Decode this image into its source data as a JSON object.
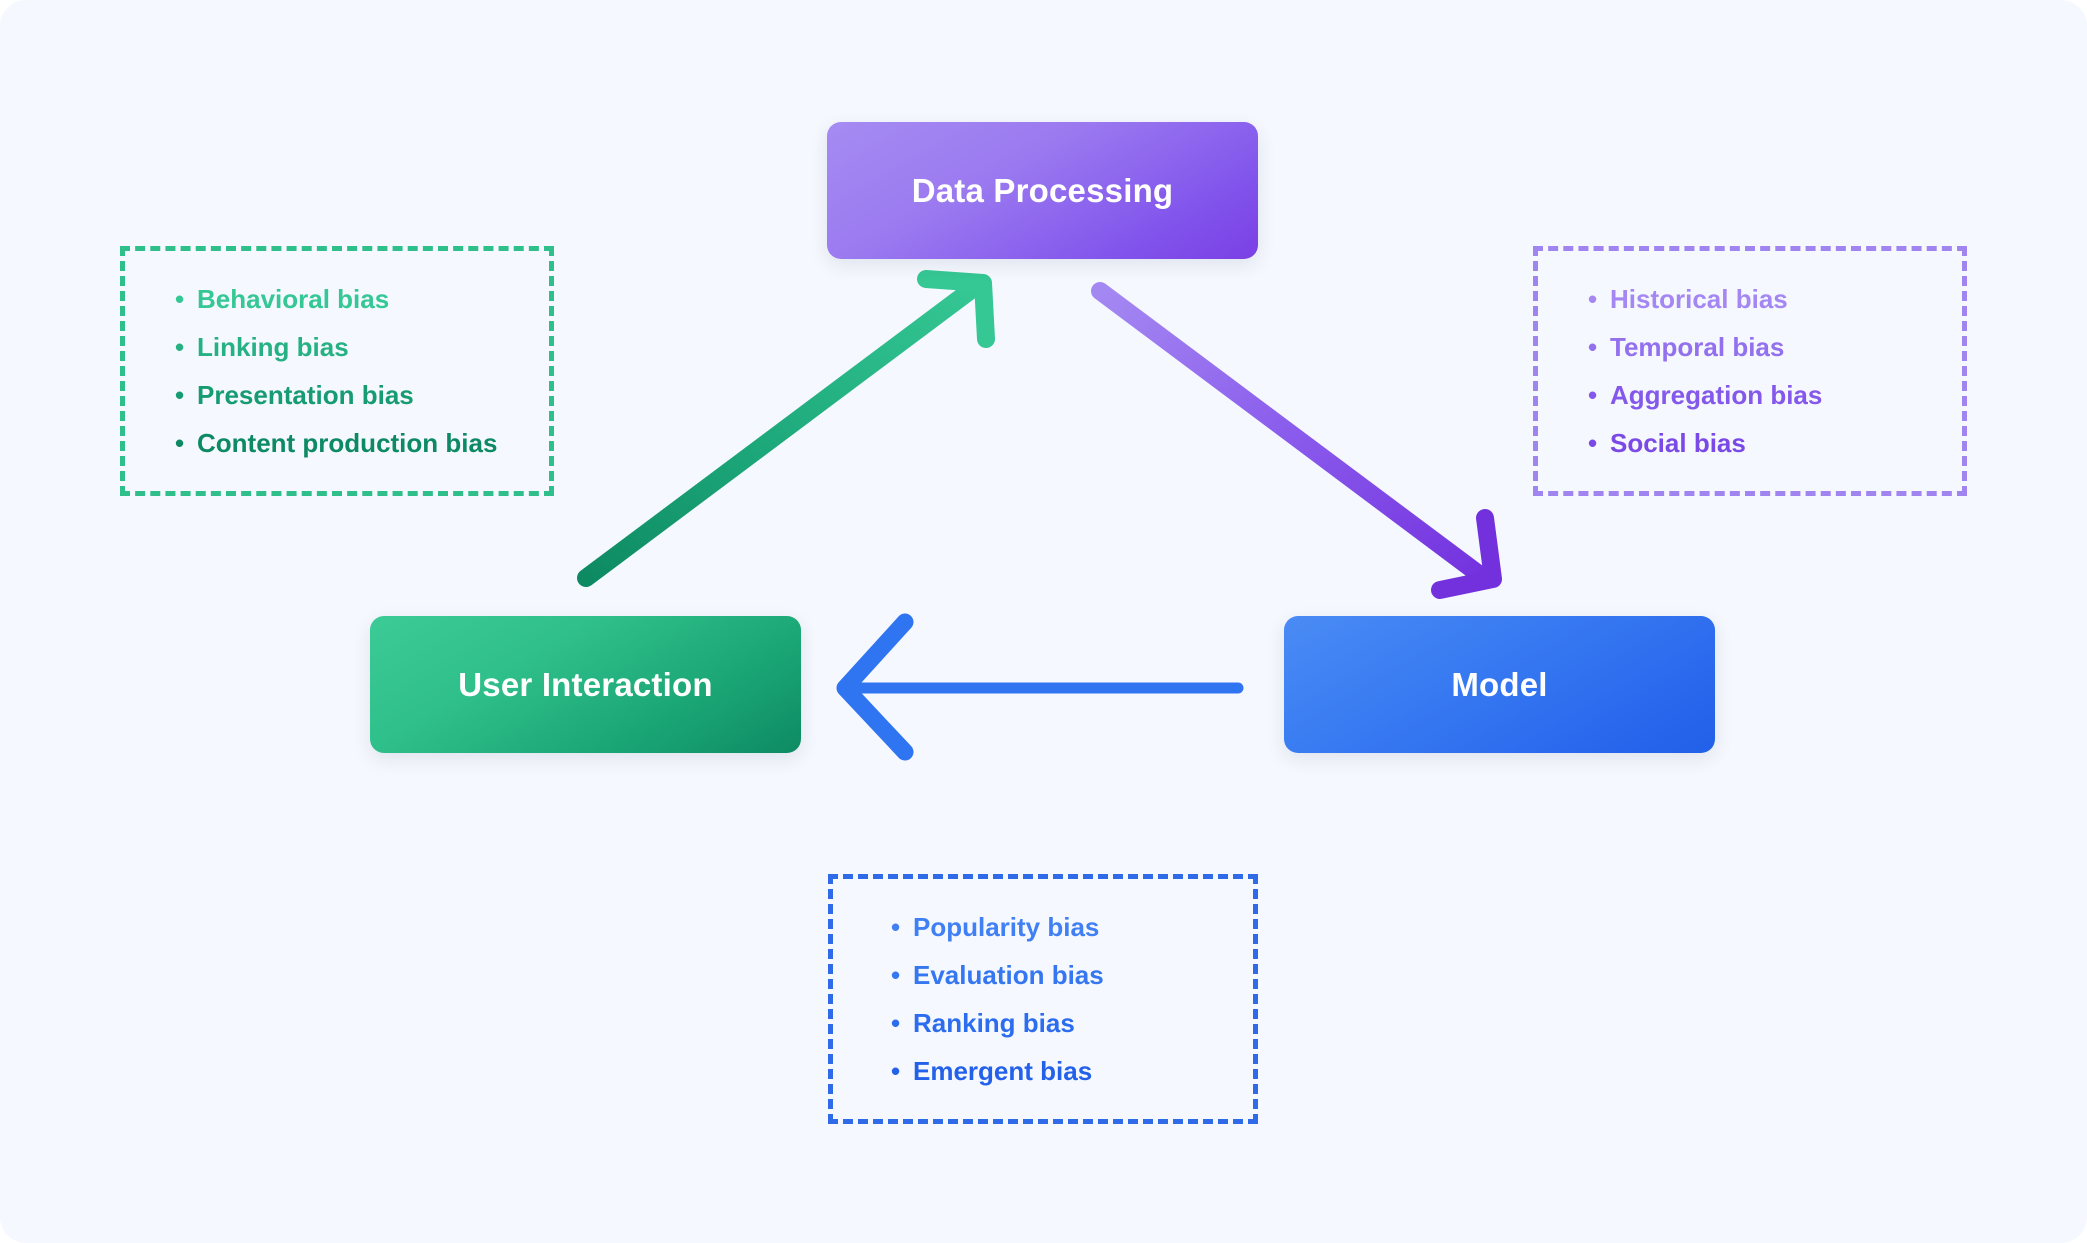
{
  "canvas": {
    "background_color": "#F5F8FE"
  },
  "nodes": [
    {
      "id": "data-processing",
      "label": "Data Processing",
      "color": "#8154EC"
    },
    {
      "id": "user-interaction",
      "label": "User Interaction",
      "color": "#18A273"
    },
    {
      "id": "model",
      "label": "Model",
      "color": "#2B6AEE"
    }
  ],
  "bias_boxes": [
    {
      "id": "user-interaction-biases",
      "border_color": "#2FBF8A",
      "bullet": "•",
      "items": [
        "Behavioral bias",
        "Linking bias",
        "Presentation bias",
        "Content production bias"
      ]
    },
    {
      "id": "data-processing-biases",
      "border_color": "#A084F0",
      "bullet": "•",
      "items": [
        "Historical bias",
        "Temporal bias",
        "Aggregation bias",
        "Social bias"
      ]
    },
    {
      "id": "model-biases",
      "border_color": "#2F6AE8",
      "bullet": "•",
      "items": [
        "Popularity bias",
        "Evaluation bias",
        "Ranking bias",
        "Emergent bias"
      ]
    }
  ],
  "arrows": [
    {
      "id": "user-interaction-to-data-processing",
      "from": "User Interaction",
      "to": "Data Processing",
      "color_start": "#0E8A62",
      "color_end": "#35C794"
    },
    {
      "id": "data-processing-to-model",
      "from": "Data Processing",
      "to": "Model",
      "color_start": "#A488F2",
      "color_end": "#7331DE"
    },
    {
      "id": "model-to-user-interaction",
      "from": "Model",
      "to": "User Interaction",
      "color_start": "#2F74F0",
      "color_end": "#2F74F0"
    }
  ]
}
